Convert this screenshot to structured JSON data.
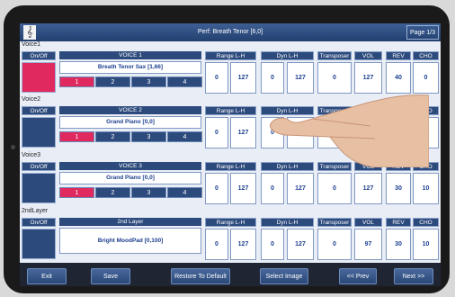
{
  "header": {
    "logo_glyph": "𝄞",
    "title": "Perf: Breath Tenor [6,0]",
    "page": "Page 1/3"
  },
  "common": {
    "onoff_label": "On/Off"
  },
  "param_headers": [
    "Range L-H",
    "Dyn L-H",
    "Transposer",
    "VOL",
    "REV",
    "CHO"
  ],
  "rows": [
    {
      "label": "Voice1",
      "head": "VOICE 1",
      "sound": "Breath Tenor Sax [1,66]",
      "parts": [
        "1",
        "2",
        "3",
        "4"
      ],
      "active_part": 0,
      "pad_color": "#e0295f",
      "values": [
        "0",
        "127",
        "0",
        "127",
        "0",
        "127",
        "40",
        "0"
      ]
    },
    {
      "label": "Voice2",
      "head": "VOICE 2",
      "sound": "Grand Piano [0,0]",
      "parts": [
        "1",
        "2",
        "3",
        "4"
      ],
      "active_part": 0,
      "pad_color": "#2c4a7c",
      "values": [
        "0",
        "127",
        "0",
        "127",
        "0",
        "127",
        "30",
        "10"
      ]
    },
    {
      "label": "Voice3",
      "head": "VOICE 3",
      "sound": "Grand Piano [0,0]",
      "parts": [
        "1",
        "2",
        "3",
        "4"
      ],
      "active_part": 0,
      "pad_color": "#2c4a7c",
      "values": [
        "0",
        "127",
        "0",
        "127",
        "0",
        "127",
        "30",
        "10"
      ]
    },
    {
      "label": "2ndLayer",
      "head": "2nd Layer",
      "sound": "Bright MoodPad [0,100]",
      "parts": [],
      "active_part": -1,
      "pad_color": "#2c4a7c",
      "values": [
        "0",
        "127",
        "0",
        "127",
        "0",
        "97",
        "30",
        "10"
      ]
    }
  ],
  "footer": {
    "exit": "Exit",
    "save": "Save",
    "restore": "Restore To Default",
    "select_image": "Select Image",
    "prev": "<< Prev",
    "next": "Next >>"
  },
  "colors": {
    "accent": "#e0295f",
    "panel": "#2c4a7c",
    "value_text": "#1c3f8f"
  }
}
